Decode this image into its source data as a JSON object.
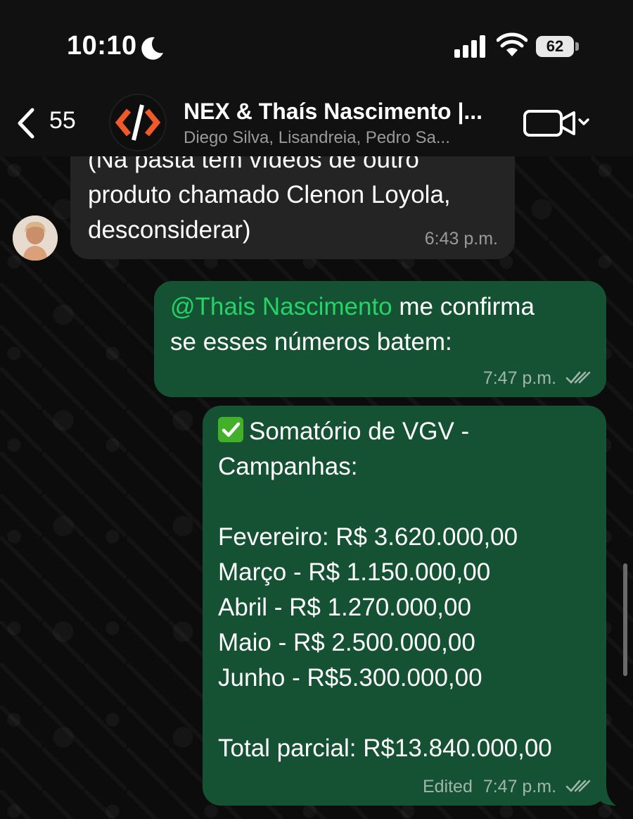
{
  "status_bar": {
    "time": "10:10",
    "battery": "62"
  },
  "header": {
    "back_count": "55",
    "group_name": "NEX & Thaís Nascimento |...",
    "members": "Diego Silva, Lisandreia, Pedro Sa..."
  },
  "messages": {
    "incoming": {
      "lines": [
        "(Na pasta tem vídeos de outro",
        "produto chamado Clenon Loyola,",
        "desconsiderar)"
      ],
      "time": "6:43 p.m."
    },
    "outgoing1": {
      "mention": "@Thais Nascimento",
      "line1_rest": " me confirma",
      "line2": "se esses números batem:",
      "time": "7:47 p.m."
    },
    "outgoing2": {
      "title_line1": "Somatório de VGV -",
      "title_line2": "Campanhas:",
      "rows": [
        "Fevereiro: R$ 3.620.000,00",
        "Março - R$ 1.150.000,00",
        "Abril - R$ 1.270.000,00",
        "Maio - R$ 2.500.000,00",
        "Junho - R$5.300.000,00"
      ],
      "total": "Total parcial: R$13.840.000,00",
      "edited": "Edited",
      "time": "7:47 p.m."
    }
  },
  "colors": {
    "outgoing_bubble": "#155234",
    "incoming_bubble": "#242424",
    "mention": "#25d366",
    "logo_orange": "#f05a28"
  }
}
